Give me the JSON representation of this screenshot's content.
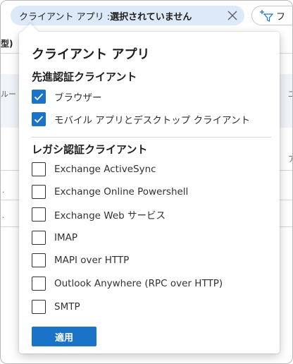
{
  "filter_bar": {
    "pill_label": "クライアント アプリ : ",
    "pill_value": "選択されていません",
    "add_filter_label": "フ"
  },
  "background": {
    "column_fragment": "型)",
    "row_fragment_left": "ルー",
    "row_fragment_right": "二",
    "row_fragment_right2": "ア",
    "dot1": ".",
    "dot2": "."
  },
  "popup": {
    "title": "クライアント アプリ",
    "modern_section": {
      "title": "先進認証クライアント",
      "options": [
        {
          "label": "ブラウザー",
          "checked": true
        },
        {
          "label": "モバイル アプリとデスクトップ クライアント",
          "checked": true
        }
      ]
    },
    "legacy_section": {
      "title": "レガシ認証クライアント",
      "options": [
        {
          "label": "Exchange ActiveSync",
          "checked": false
        },
        {
          "label": "Exchange Online Powershell",
          "checked": false
        },
        {
          "label": "Exchange Web サービス",
          "checked": false
        },
        {
          "label": "IMAP",
          "checked": false
        },
        {
          "label": "MAPI over HTTP",
          "checked": false
        },
        {
          "label": "Outlook Anywhere (RPC over HTTP)",
          "checked": false
        },
        {
          "label": "SMTP",
          "checked": false
        }
      ]
    },
    "apply_label": "適用"
  },
  "colors": {
    "accent": "#1a73c7",
    "pill_bg": "#dbe9f8"
  }
}
